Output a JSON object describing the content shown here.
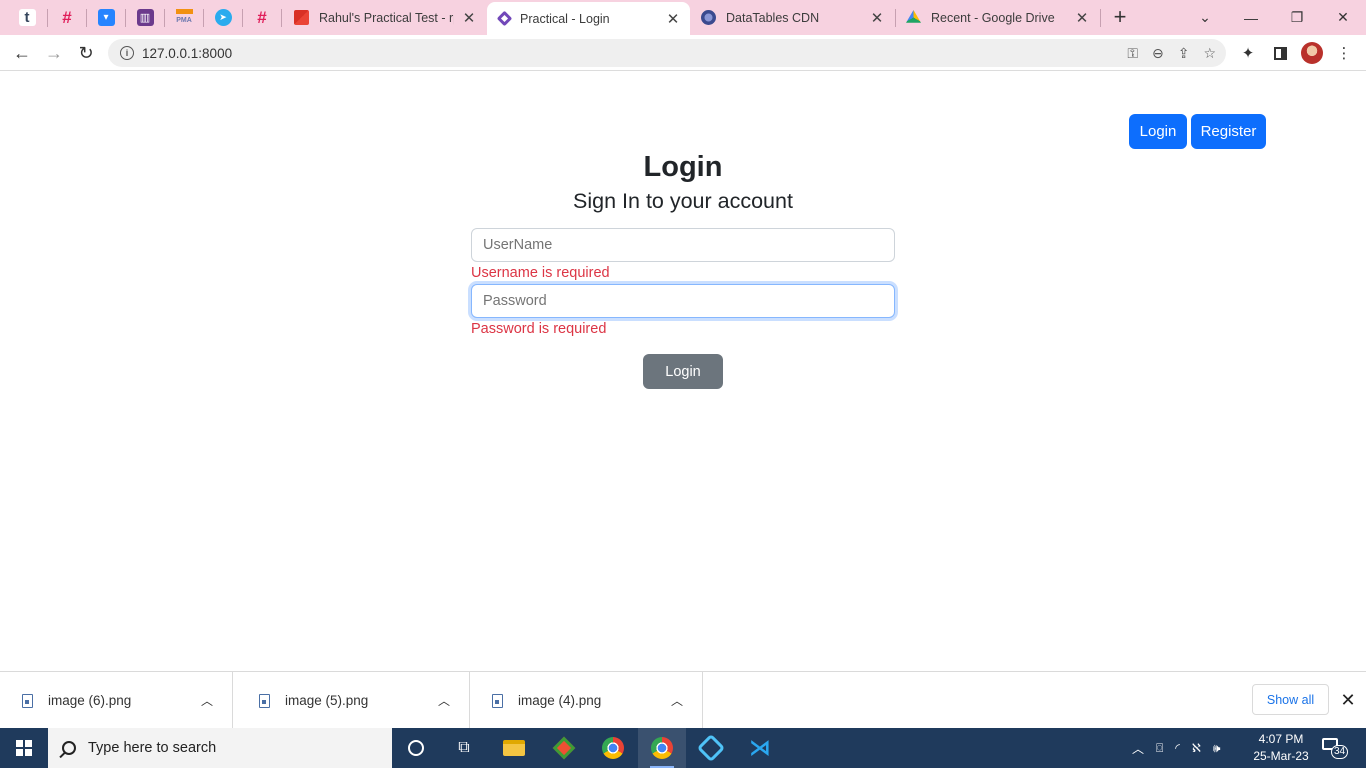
{
  "browser": {
    "pinned_tabs": [
      {
        "icon": "tumblr-icon",
        "glyph": "t",
        "color": "#ffffff",
        "fg": "#36465d"
      },
      {
        "icon": "slack-icon",
        "glyph": "#",
        "color": "#e01e5a",
        "fg": "#ffffff"
      },
      {
        "icon": "bitbucket-icon",
        "glyph": "▾",
        "color": "#2684ff",
        "fg": "#ffffff"
      },
      {
        "icon": "trello-icon",
        "glyph": "▥",
        "color": "#6b3a8c",
        "fg": "#ffffff"
      },
      {
        "icon": "phpmyadmin-icon",
        "glyph": "PMA",
        "color": "#f29111",
        "fg": "#6c78af"
      },
      {
        "icon": "telegram-icon",
        "glyph": "➤",
        "color": "#2aabee",
        "fg": "#ffffff"
      },
      {
        "icon": "slack-icon",
        "glyph": "#",
        "color": "#e01e5a",
        "fg": "#ffffff"
      }
    ],
    "tabs": [
      {
        "title": "Rahul's Practical Test - rpa",
        "favicon": "gmail-icon",
        "color": "#d93025",
        "active": false
      },
      {
        "title": "Practical - Login",
        "favicon": "diamond-icon",
        "color": "#7248b9",
        "active": true
      },
      {
        "title": "DataTables CDN",
        "favicon": "datatables-icon",
        "color": "#3b4a8f",
        "active": false
      },
      {
        "title": "Recent - Google Drive",
        "favicon": "google-drive-icon",
        "color": "#1fa463",
        "active": false
      }
    ],
    "url": "127.0.0.1:8000"
  },
  "page": {
    "nav_buttons": {
      "login": "Login",
      "register": "Register"
    },
    "heading": "Login",
    "subheading": "Sign In to your account",
    "form": {
      "username_placeholder": "UserName",
      "username_value": "",
      "username_error": "Username is required",
      "password_placeholder": "Password",
      "password_value": "",
      "password_error": "Password is required",
      "submit_label": "Login"
    }
  },
  "downloads": {
    "items": [
      {
        "name": "image (6).png"
      },
      {
        "name": "image (5).png"
      },
      {
        "name": "image (4).png"
      }
    ],
    "show_all": "Show all"
  },
  "taskbar": {
    "search_placeholder": "Type here to search",
    "time": "4:07 PM",
    "date": "25-Mar-23",
    "notification_count": "34"
  },
  "colors": {
    "tab_strip": "#f7d2e0",
    "primary": "#0d6efd",
    "secondary": "#6c757d",
    "error": "#dc3545",
    "taskbar": "#1f3a5c"
  }
}
